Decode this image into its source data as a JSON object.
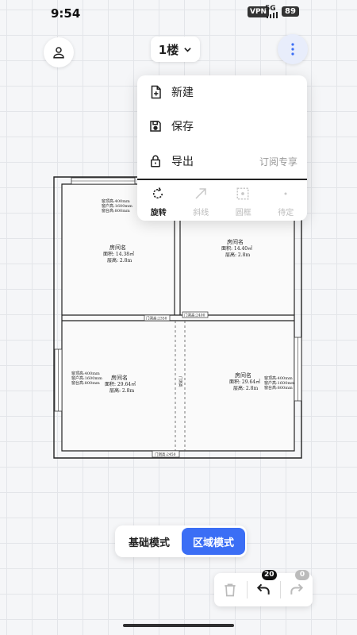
{
  "status": {
    "time": "9:54",
    "vpn": "VPN",
    "network": "5G",
    "battery": "89"
  },
  "header": {
    "floor_label": "1楼"
  },
  "menu": {
    "items": [
      {
        "label": "新建"
      },
      {
        "label": "保存"
      },
      {
        "label": "导出",
        "extra": "订阅专享"
      }
    ],
    "tools": [
      {
        "label": "旋转",
        "active": true
      },
      {
        "label": "斜线",
        "active": false
      },
      {
        "label": "圆框",
        "active": false
      },
      {
        "label": "待定",
        "active": false
      }
    ]
  },
  "plan": {
    "rooms": [
      {
        "name": "房间名",
        "area": "面积: 14.38㎡",
        "height": "层高: 2.8m",
        "specs": [
          "窗顶高:400mm",
          "窗户高:1600mm",
          "窗台高:800mm"
        ]
      },
      {
        "name": "房间名",
        "area": "面积: 14.40㎡",
        "height": "层高: 2.8m"
      },
      {
        "name": "房间名",
        "area": "面积: 29.64㎡",
        "height": "层高: 2.8m",
        "specs": [
          "窗顶高:400mm",
          "窗户高:1600mm",
          "窗台高:800mm"
        ]
      },
      {
        "name": "房间名",
        "area": "面积: 29.64㎡",
        "height": "层高: 2.8m",
        "specs": [
          "窗顶高:400mm",
          "窗户高:1600mm",
          "窗台高:800mm"
        ]
      }
    ],
    "door_labels": [
      "门洞高:2350",
      "门洞高:2400",
      "门洞高:2450"
    ],
    "vertical_door_label": "门洞高"
  },
  "modes": {
    "basic": "基础模式",
    "area": "区域模式"
  },
  "actions": {
    "undo_count": "20",
    "redo_count": "0"
  }
}
